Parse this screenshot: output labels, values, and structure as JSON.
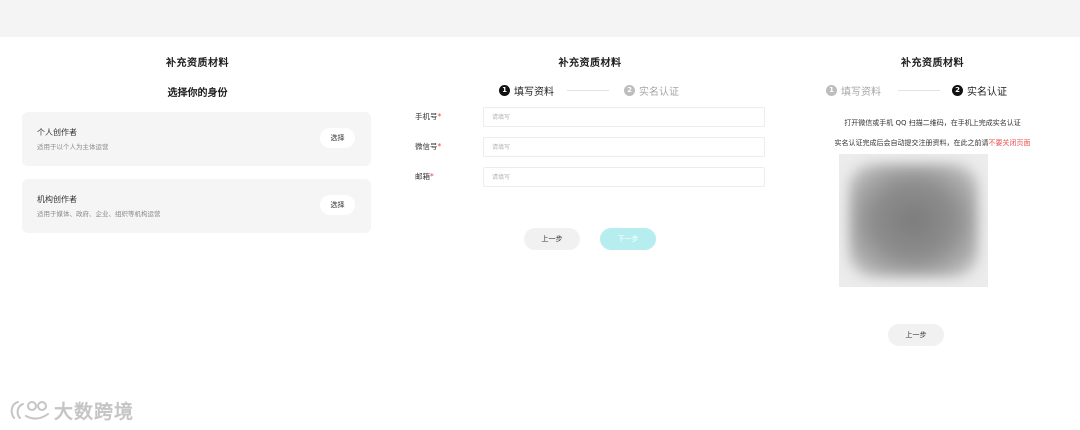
{
  "panel1": {
    "title": "补充资质材料",
    "subtitle": "选择你的身份",
    "cards": [
      {
        "name": "个人创作者",
        "desc": "适用于以个人为主体运营",
        "button": "选择"
      },
      {
        "name": "机构创作者",
        "desc": "适用于媒体、政府、企业、组织等机构运营",
        "button": "选择"
      }
    ]
  },
  "panel2": {
    "title": "补充资质材料",
    "steps": [
      {
        "num": "1",
        "label": "填写资料",
        "active": true
      },
      {
        "num": "2",
        "label": "实名认证",
        "active": false
      }
    ],
    "fields": [
      {
        "label": "手机号",
        "required": "*",
        "placeholder": "请填写"
      },
      {
        "label": "微信号",
        "required": "*",
        "placeholder": "请填写"
      },
      {
        "label": "邮箱",
        "required": "*",
        "placeholder": "请填写"
      }
    ],
    "prev_button": "上一步",
    "next_button": "下一步"
  },
  "panel3": {
    "title": "补充资质材料",
    "steps": [
      {
        "num": "1",
        "label": "填写资料",
        "active": false
      },
      {
        "num": "2",
        "label": "实名认证",
        "active": true
      }
    ],
    "tip1": "打开微信或手机 QQ 扫描二维码，在手机上完成实名认证",
    "tip2_main": "实名认证完成后会自动提交注册资料，在此之前请",
    "tip2_red": "不要关闭页面",
    "prev_button": "上一步"
  },
  "watermark": {
    "text": "大数跨境"
  },
  "colors": {
    "topbar": "#f4f4f5",
    "card_bg": "#f5f5f6",
    "accent_teal": "#b6eeef",
    "required_red": "#e54545",
    "warning_red": "#ee4f4f"
  }
}
